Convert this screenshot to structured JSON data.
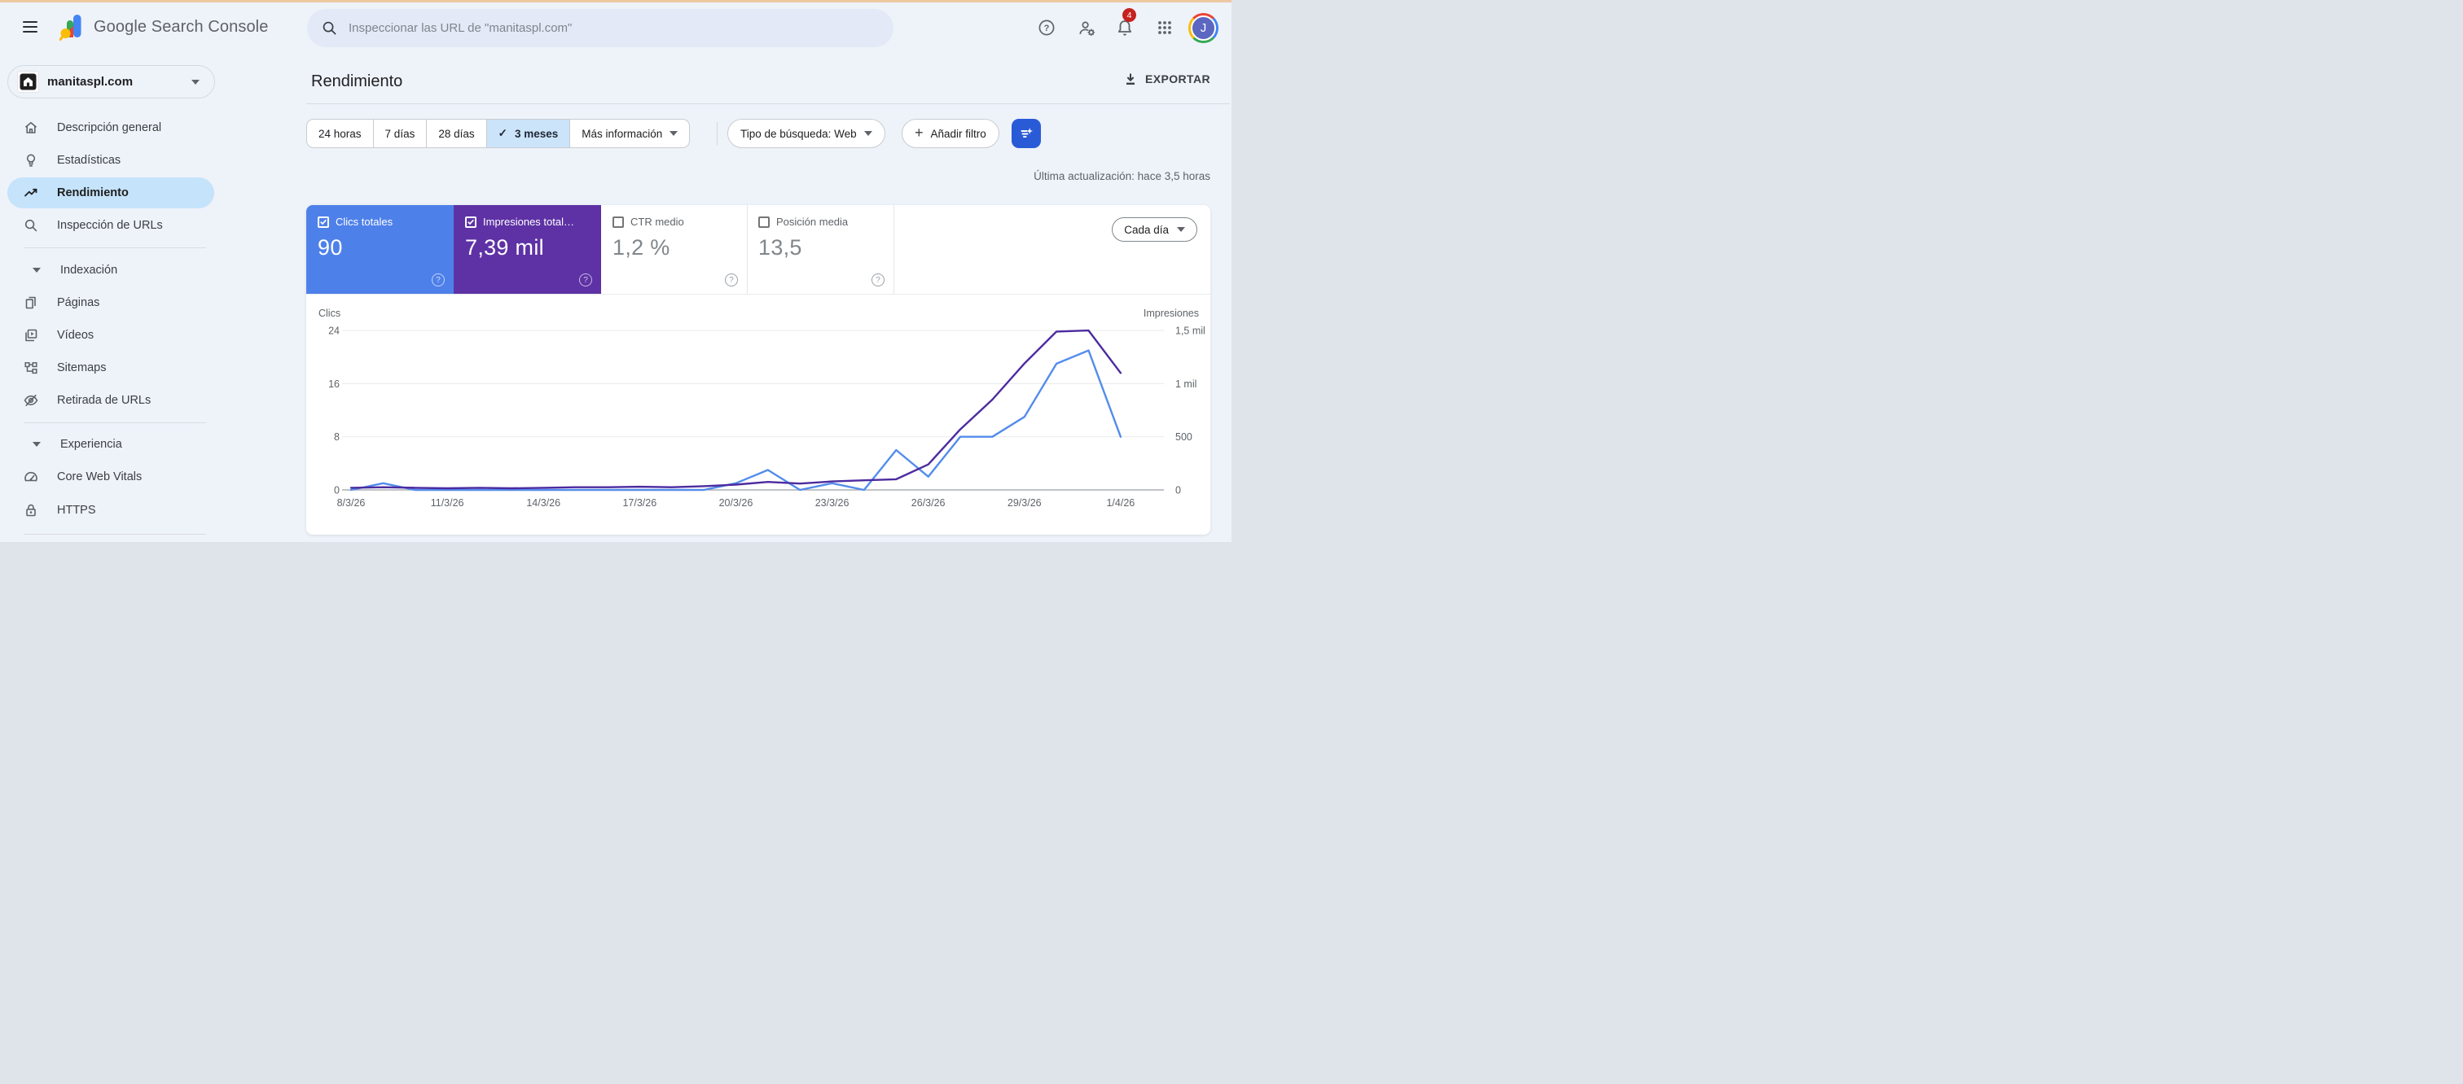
{
  "header": {
    "product_name": "Google Search Console",
    "search_placeholder": "Inspeccionar las URL de \"manitaspl.com\"",
    "notifications_badge": "4",
    "avatar_initial": "J"
  },
  "icons": {
    "plus": "+",
    "question": "?",
    "check": "✓"
  },
  "colors": {
    "card_blue": "#4e80e9",
    "card_purple": "#5e32a5",
    "line_clicks": "#548ceb",
    "line_impressions": "#4c2b9f",
    "selected_nav_bg": "#c5e3fb",
    "filter_button_blue": "#2a5bd7",
    "badge_red": "#c5221f"
  },
  "sidebar": {
    "property": {
      "name": "manitaspl.com"
    },
    "items": [
      {
        "label": "Descripción general",
        "icon": "home"
      },
      {
        "label": "Estadísticas",
        "icon": "lightbulb"
      },
      {
        "label": "Rendimiento",
        "icon": "trending-up",
        "selected": true
      },
      {
        "label": "Inspección de URLs",
        "icon": "search"
      }
    ],
    "sections": [
      {
        "label": "Indexación",
        "items": [
          {
            "label": "Páginas",
            "icon": "pages"
          },
          {
            "label": "Vídeos",
            "icon": "video"
          },
          {
            "label": "Sitemaps",
            "icon": "sitemap"
          },
          {
            "label": "Retirada de URLs",
            "icon": "eye-off"
          }
        ]
      },
      {
        "label": "Experiencia",
        "items": [
          {
            "label": "Core Web Vitals",
            "icon": "speed"
          },
          {
            "label": "HTTPS",
            "icon": "lock"
          }
        ]
      }
    ]
  },
  "main": {
    "title": "Rendimiento",
    "export_label": "EXPORTAR",
    "date_filters": [
      "24 horas",
      "7 días",
      "28 días",
      "3 meses",
      "Más información"
    ],
    "selected_date_filter": "3 meses",
    "search_type_filter": "Tipo de búsqueda: Web",
    "add_filter_label": "Añadir filtro",
    "last_update": "Última actualización: hace 3,5 horas",
    "granularity": "Cada día",
    "metric_cards": [
      {
        "label": "Clics totales",
        "value": "90",
        "checked": true,
        "color": "#4e80e9"
      },
      {
        "label": "Impresiones total…",
        "value": "7,39 mil",
        "checked": true,
        "color": "#5e32a5"
      },
      {
        "label": "CTR medio",
        "value": "1,2 %",
        "checked": false
      },
      {
        "label": "Posición media",
        "value": "13,5",
        "checked": false
      }
    ]
  },
  "chart_data": {
    "type": "line",
    "x": [
      "8/3/26",
      "9/3/26",
      "10/3/26",
      "11/3/26",
      "12/3/26",
      "13/3/26",
      "14/3/26",
      "15/3/26",
      "16/3/26",
      "17/3/26",
      "18/3/26",
      "19/3/26",
      "20/3/26",
      "21/3/26",
      "22/3/26",
      "23/3/26",
      "24/3/26",
      "25/3/26",
      "26/3/26",
      "27/3/26",
      "28/3/26",
      "29/3/26",
      "30/3/26",
      "31/3/26",
      "1/4/26"
    ],
    "x_tick_labels": [
      "8/3/26",
      "11/3/26",
      "14/3/26",
      "17/3/26",
      "20/3/26",
      "23/3/26",
      "26/3/26",
      "29/3/26",
      "1/4/26"
    ],
    "series": [
      {
        "name": "Clics",
        "axis": "left",
        "color": "#548ceb",
        "values": [
          0,
          1,
          0,
          0,
          0,
          0,
          0,
          0,
          0,
          0,
          0,
          0,
          1,
          3,
          0,
          1,
          0,
          6,
          2,
          8,
          8,
          11,
          19,
          21,
          8
        ]
      },
      {
        "name": "Impresiones",
        "axis": "right",
        "color": "#4c2b9f",
        "values": [
          20,
          25,
          20,
          15,
          20,
          15,
          20,
          25,
          25,
          30,
          25,
          35,
          50,
          75,
          60,
          80,
          90,
          100,
          240,
          570,
          850,
          1190,
          1490,
          1500,
          1100
        ]
      }
    ],
    "left_axis": {
      "label": "Clics",
      "ticks": [
        0,
        8,
        16,
        24
      ],
      "range": [
        0,
        24
      ]
    },
    "right_axis": {
      "label": "Impresiones",
      "tick_labels": [
        "0",
        "500",
        "1 mil",
        "1,5 mil"
      ],
      "range": [
        0,
        1500
      ]
    },
    "grid": true,
    "legend_position": "none"
  }
}
